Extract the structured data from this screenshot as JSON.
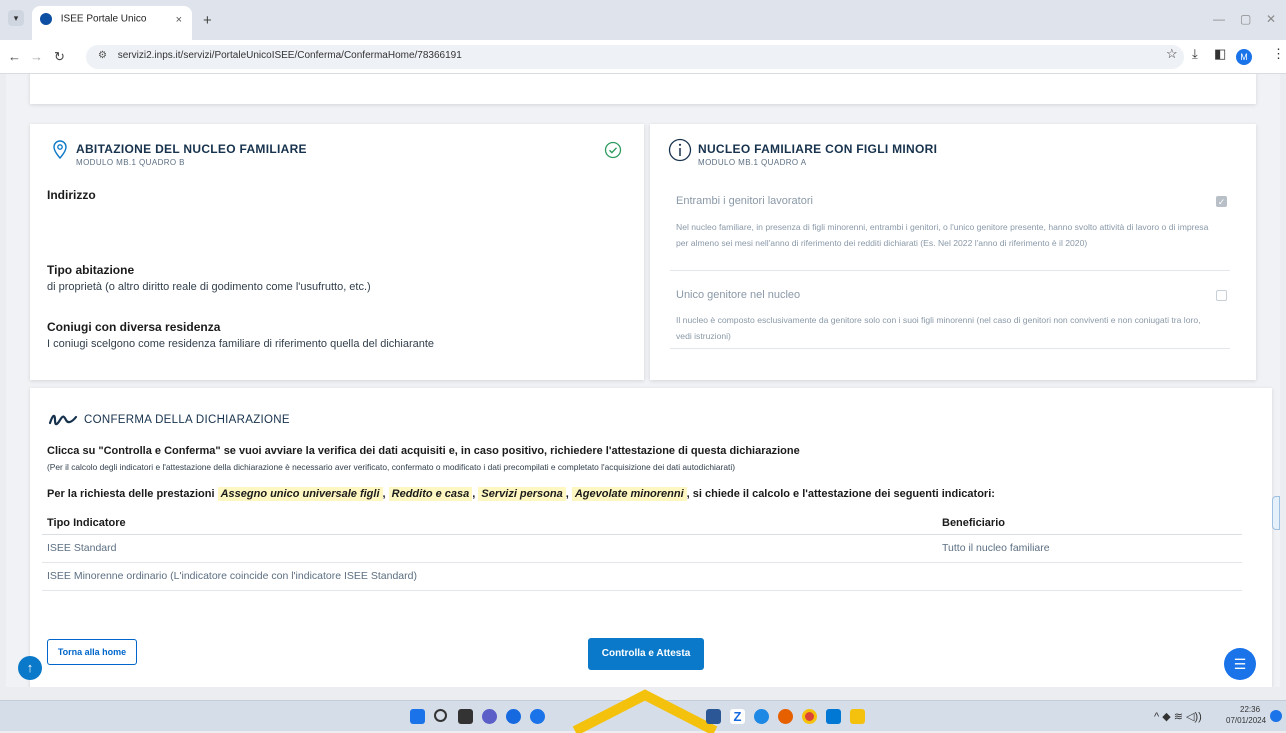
{
  "browser": {
    "tab_title": "ISEE Portale Unico",
    "tab_close": "×",
    "new_tab": "+",
    "url": "servizi2.inps.it/servizi/PortaleUnicoISEE/Conferma/ConfermaHome/78366191",
    "profile_initial": "M"
  },
  "abitazione": {
    "title": "ABITAZIONE DEL NUCLEO FAMILIARE",
    "subtitle": "MODULO MB.1 QUADRO B",
    "indirizzo_label": "Indirizzo",
    "tipo_label": "Tipo abitazione",
    "tipo_value": "di proprietà (o altro diritto reale di godimento come l'usufrutto, etc.)",
    "coniugi_label": "Coniugi con diversa residenza",
    "coniugi_value": "I coniugi scelgono come residenza familiare di riferimento quella del dichiarante"
  },
  "nucleo": {
    "title": "NUCLEO FAMILIARE CON FIGLI MINORI",
    "subtitle": "MODULO MB.1 QUADRO A",
    "item1_label": "Entrambi i genitori lavoratori",
    "item1_desc": "Nel nucleo familiare, in presenza di figli minorenni, entrambi i genitori, o l'unico genitore presente, hanno svolto attività di lavoro o di impresa per almeno sei mesi nell'anno di riferimento dei redditi dichiarati (Es. Nel 2022 l'anno di riferimento è il 2020)",
    "item2_label": "Unico genitore nel nucleo",
    "item2_desc": "Il nucleo è composto esclusivamente da genitore solo con i suoi figli minorenni (nel caso di genitori non conviventi e non coniugati tra loro, vedi istruzioni)"
  },
  "conferma": {
    "title": "CONFERMA DELLA DICHIARAZIONE",
    "instruction": "Clicca su \"Controlla e Conferma\" se vuoi avviare la verifica dei dati acquisiti e, in caso positivo, richiedere l'attestazione di questa dichiarazione",
    "note": "(Per il calcolo degli indicatori e l'attestazione della dichiarazione è necessario aver verificato, confermato o modificato i dati precompilati e completato l'acquisizione dei dati autodichiarati)",
    "req_prefix": "Per la richiesta delle prestazioni",
    "prestazioni": [
      "Assegno unico universale figli",
      "Reddito e casa",
      "Servizi persona",
      "Agevolate minorenni"
    ],
    "req_suffix": ", si chiede il calcolo e l'attestazione dei seguenti indicatori:",
    "col_tipo": "Tipo Indicatore",
    "col_beneficiario": "Beneficiario",
    "rows": [
      {
        "tipo": "ISEE Standard",
        "beneficiario": "Tutto il nucleo familiare"
      },
      {
        "tipo": "ISEE Minorenne ordinario (L'indicatore coincide con l'indicatore ISEE Standard)",
        "beneficiario": ""
      }
    ],
    "home_button": "Torna alla home",
    "attesta_button": "Controlla e Attesta"
  },
  "taskbar": {
    "time": "22:36",
    "date": "07/01/2024"
  },
  "colors": {
    "primary": "#0b79c9",
    "heading": "#17324d",
    "highlight": "#fff7c2",
    "check_ok": "#2e9b5f"
  }
}
